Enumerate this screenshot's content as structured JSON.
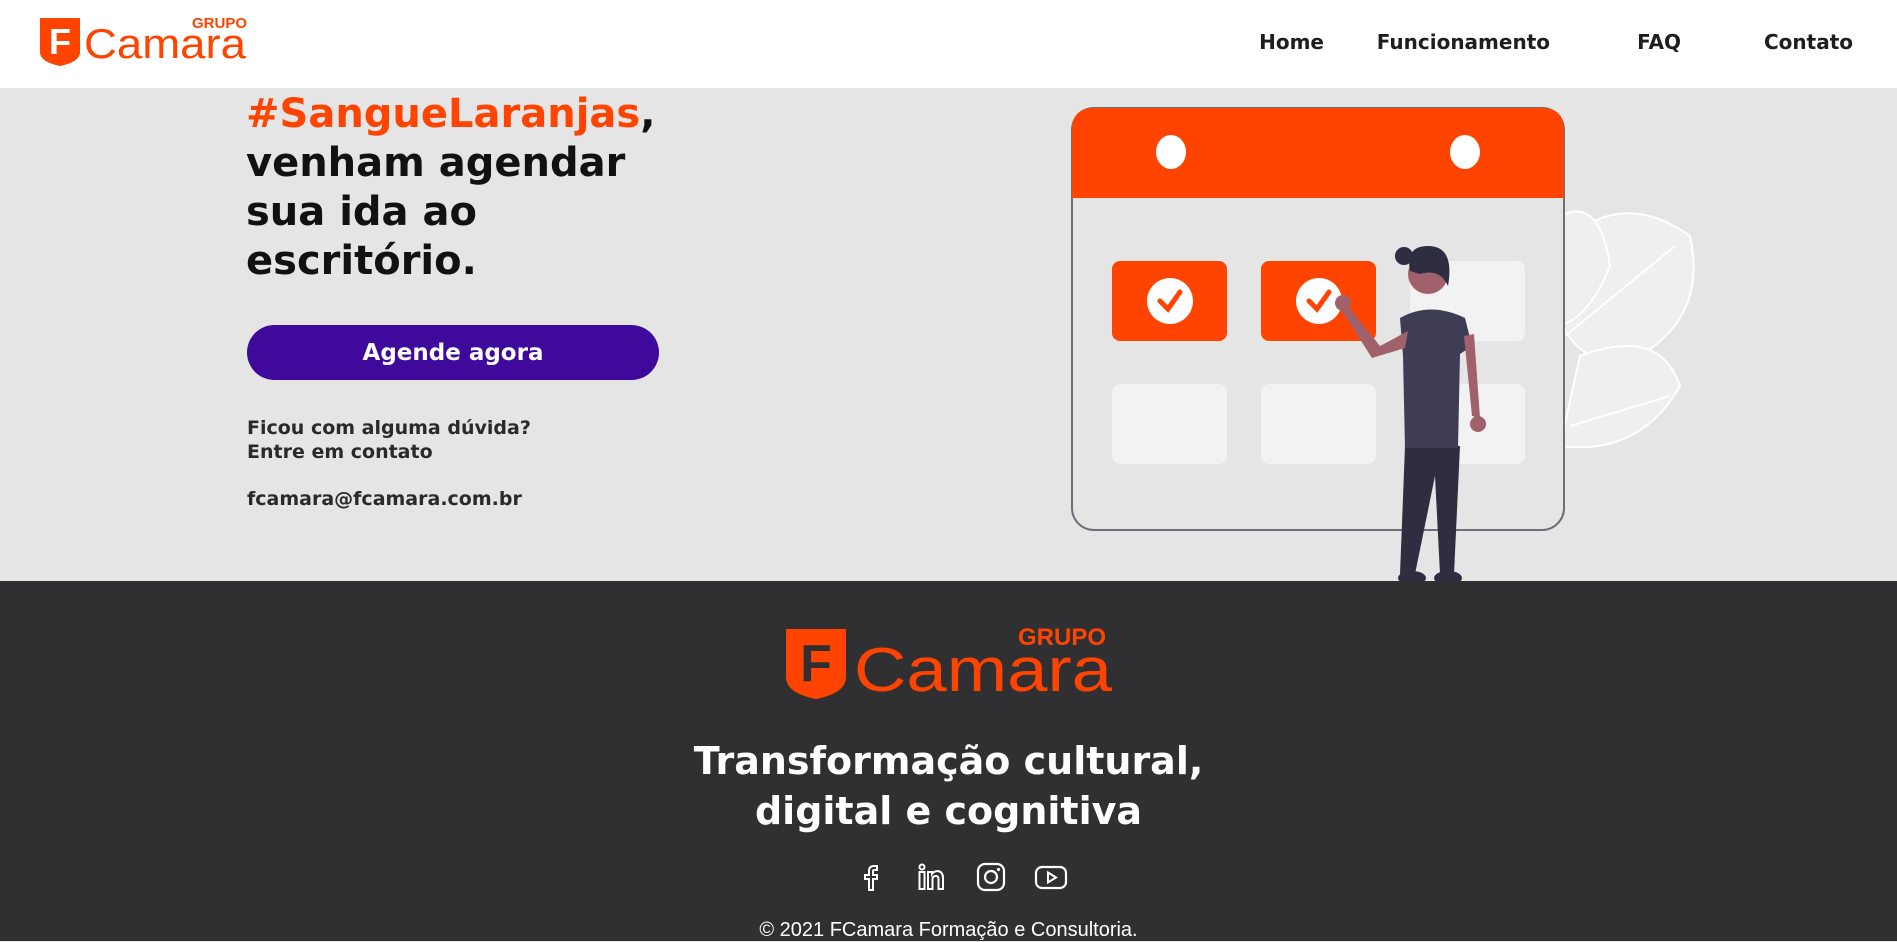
{
  "brand": {
    "logo_small": "GRUPO",
    "logo_name": "Camara",
    "logo_letter": "F",
    "accent_color": "#fe4400",
    "purple_color": "#3f0a9b"
  },
  "nav": {
    "items": [
      {
        "label": "Home"
      },
      {
        "label": "Funcionamento"
      },
      {
        "label": "FAQ"
      },
      {
        "label": "Contato"
      }
    ]
  },
  "hero": {
    "headline_accent": "#SangueLaranjas",
    "headline_comma": ",",
    "headline_rest": "venham agendar sua ida ao escritório.",
    "cta_label": "Agende agora",
    "doubt_line1": "Ficou com alguma dúvida?",
    "doubt_line2": "Entre em contato",
    "email": "fcamara@fcamara.com.br"
  },
  "footer": {
    "tagline_line1": "Transformação cultural,",
    "tagline_line2": "digital e cognitiva",
    "socials": [
      {
        "icon": "facebook-icon"
      },
      {
        "icon": "linkedin-icon"
      },
      {
        "icon": "instagram-icon"
      },
      {
        "icon": "youtube-icon"
      }
    ],
    "copyright": "© 2021 FCamara Formação e Consultoria."
  }
}
